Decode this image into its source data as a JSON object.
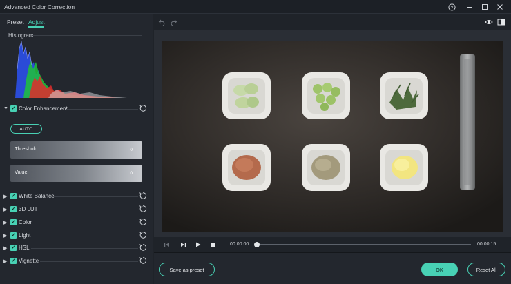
{
  "window": {
    "title": "Advanced Color Correction",
    "help_icon": "help-icon",
    "minimize_icon": "minimize-icon",
    "maximize_icon": "maximize-icon",
    "close_icon": "close-icon"
  },
  "tabs": [
    {
      "label": "Preset",
      "active": false
    },
    {
      "label": "Adjust",
      "active": true
    }
  ],
  "histogram": {
    "label": "Histogram"
  },
  "color_enhancement": {
    "label": "Color Enhancement",
    "checked": true,
    "expanded": true,
    "auto_label": "AUTO",
    "threshold_label": "Threshold",
    "threshold_value": "0",
    "value_label": "Value",
    "value_value": "0"
  },
  "sections": [
    {
      "label": "White Balance",
      "checked": true
    },
    {
      "label": "3D LUT",
      "checked": true
    },
    {
      "label": "Color",
      "checked": true
    },
    {
      "label": "Light",
      "checked": true
    },
    {
      "label": "HSL",
      "checked": true
    },
    {
      "label": "Vignette",
      "checked": true
    }
  ],
  "toolbar": {
    "undo_icon": "undo-icon",
    "redo_icon": "redo-icon",
    "eye_icon": "eye-icon",
    "compare_icon": "compare-icon"
  },
  "playback": {
    "current_time": "00:00:00",
    "total_time": "00:00:15",
    "progress": 0
  },
  "footer": {
    "save_preset_label": "Save as preset",
    "ok_label": "OK",
    "reset_all_label": "Reset All"
  },
  "colors": {
    "accent": "#48d1b4",
    "panel": "#23272e",
    "background": "#1f2329"
  }
}
